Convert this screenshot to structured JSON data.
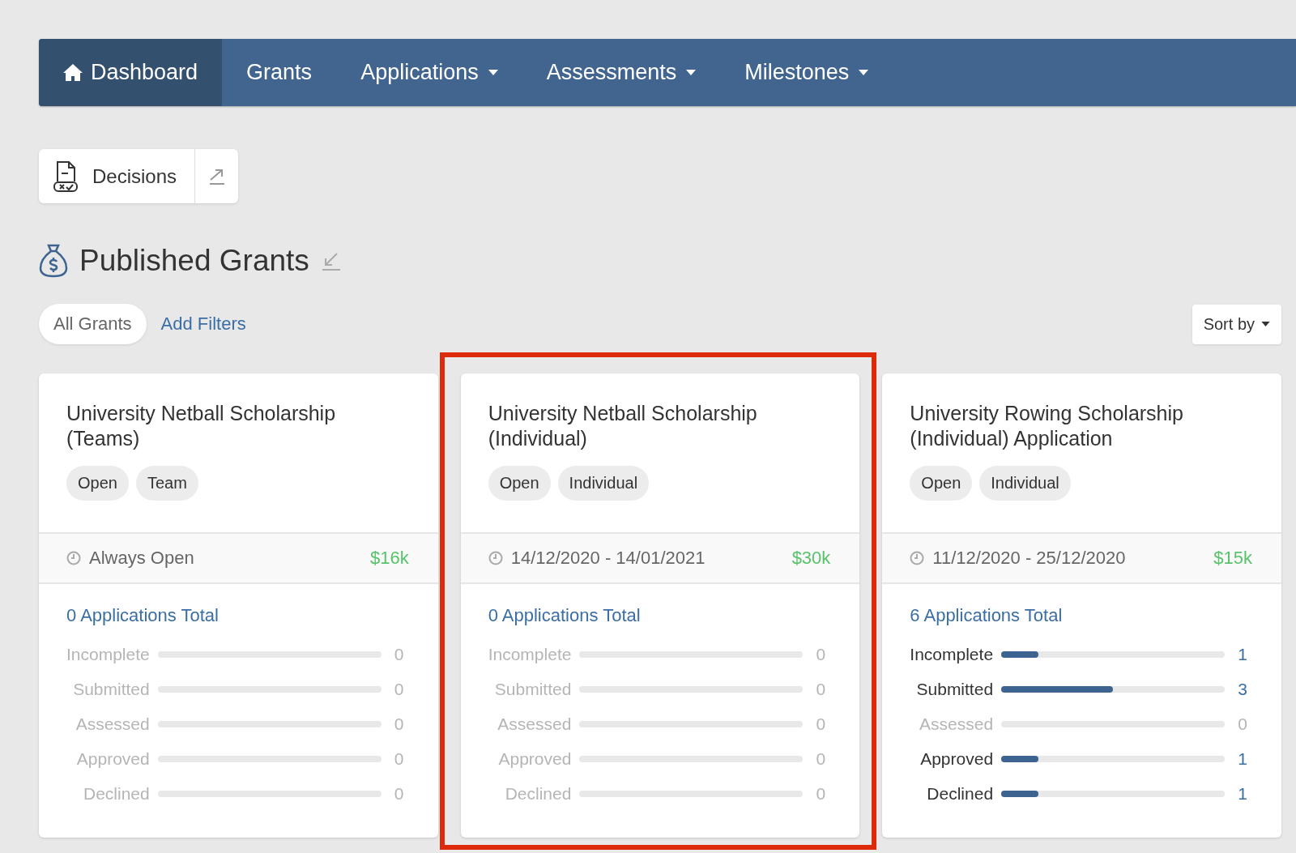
{
  "nav": {
    "items": [
      {
        "label": "Dashboard",
        "selected": true,
        "has_icon": true,
        "dropdown": false
      },
      {
        "label": "Grants",
        "selected": false,
        "has_icon": false,
        "dropdown": false
      },
      {
        "label": "Applications",
        "selected": false,
        "has_icon": false,
        "dropdown": true
      },
      {
        "label": "Assessments",
        "selected": false,
        "has_icon": false,
        "dropdown": true
      },
      {
        "label": "Milestones",
        "selected": false,
        "has_icon": false,
        "dropdown": true
      }
    ]
  },
  "decisions_button": {
    "label": "Decisions"
  },
  "section": {
    "title": "Published Grants"
  },
  "filters": {
    "chips": [
      {
        "label": "All Grants",
        "selected": true
      }
    ],
    "add_filters": "Add Filters",
    "sort": "Sort by"
  },
  "grants": [
    {
      "title": "University Netball Scholarship (Teams)",
      "tags": [
        "Open",
        "Team"
      ],
      "period": "Always Open",
      "amount": "$16k",
      "total": "0 Applications Total",
      "highlighted": false,
      "stats": [
        {
          "label": "Incomplete",
          "count": "0",
          "level": 0
        },
        {
          "label": "Submitted",
          "count": "0",
          "level": 0
        },
        {
          "label": "Assessed",
          "count": "0",
          "level": 0
        },
        {
          "label": "Approved",
          "count": "0",
          "level": 0
        },
        {
          "label": "Declined",
          "count": "0",
          "level": 0
        }
      ]
    },
    {
      "title": "University Netball Scholarship (Individual)",
      "tags": [
        "Open",
        "Individual"
      ],
      "period": "14/12/2020 - 14/01/2021",
      "amount": "$30k",
      "total": "0 Applications Total",
      "highlighted": true,
      "stats": [
        {
          "label": "Incomplete",
          "count": "0",
          "level": 0
        },
        {
          "label": "Submitted",
          "count": "0",
          "level": 0
        },
        {
          "label": "Assessed",
          "count": "0",
          "level": 0
        },
        {
          "label": "Approved",
          "count": "0",
          "level": 0
        },
        {
          "label": "Declined",
          "count": "0",
          "level": 0
        }
      ]
    },
    {
      "title": "University Rowing Scholarship (Individual) Application",
      "tags": [
        "Open",
        "Individual"
      ],
      "period": "11/12/2020 - 25/12/2020",
      "amount": "$15k",
      "total": "6 Applications Total",
      "highlighted": false,
      "stats": [
        {
          "label": "Incomplete",
          "count": "1",
          "level": 0.167
        },
        {
          "label": "Submitted",
          "count": "3",
          "level": 0.5
        },
        {
          "label": "Assessed",
          "count": "0",
          "level": 0
        },
        {
          "label": "Approved",
          "count": "1",
          "level": 0.167
        },
        {
          "label": "Declined",
          "count": "1",
          "level": 0.167
        }
      ]
    }
  ]
}
